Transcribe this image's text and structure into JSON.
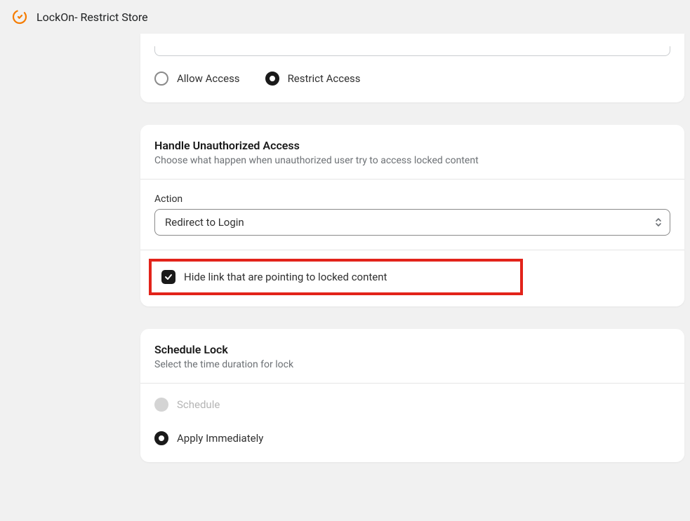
{
  "header": {
    "title": "LockOn- Restrict Store"
  },
  "accessCard": {
    "allow_label": "Allow Access",
    "restrict_label": "Restrict Access"
  },
  "unauthorizedCard": {
    "title": "Handle Unauthorized Access",
    "subtitle": "Choose what happen when unauthorized user try to access locked content",
    "action_label": "Action",
    "action_value": "Redirect to Login",
    "hide_link_label": "Hide link that are pointing to locked content"
  },
  "scheduleCard": {
    "title": "Schedule Lock",
    "subtitle": "Select the time duration for lock",
    "schedule_label": "Schedule",
    "apply_label": "Apply Immediately"
  }
}
